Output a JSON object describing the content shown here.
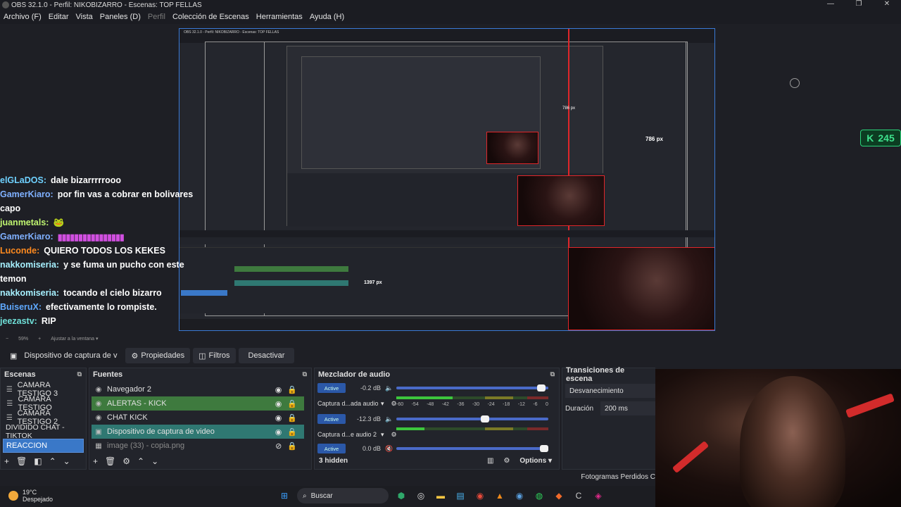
{
  "window": {
    "title": "OBS 32.1.0 - Perfil: NIKOBIZARRO - Escenas: TOP FELLAS",
    "controls": [
      "—",
      "❐",
      "✕"
    ]
  },
  "menu": {
    "items": [
      "Archivo (F)",
      "Editar",
      "Vista",
      "Paneles (D)",
      "Perfil",
      "Colección de Escenas",
      "Herramientas",
      "Ayuda (H)"
    ]
  },
  "preview": {
    "badge": "245",
    "nested_title": "OBS 32.1.0 - Perfil: NIKOBIZARRO - Escenas: TOP FELLAS",
    "nested_size_label": "786 px",
    "nested_size_label_2": "786 px",
    "nested_x_label": "1397 px"
  },
  "chat": {
    "lines": [
      {
        "user": "elGLaDOS:",
        "msg": "dale bizarrrrrooo",
        "color": "#6fd1ff"
      },
      {
        "user": "GamerKiaro:",
        "msg": "por fin vas a cobrar en bolivares",
        "color": "#7fb0ff"
      },
      {
        "user": "",
        "msg": "capo",
        "color": "#ffffff"
      },
      {
        "user": "juanmetals:",
        "msg": "🐸",
        "color": "#bff570"
      },
      {
        "user": "GamerKiaro:",
        "msg": "▮▮▮▮▮▮▮▮▮▮▮▮▮▮▮▮",
        "color": "#7fb0ff"
      },
      {
        "user": "Luconde:",
        "msg": "QUIERO TODOS LOS KEKES",
        "color": "#ff8a1f"
      },
      {
        "user": "nakkomiseria:",
        "msg": "y se fuma un pucho con este",
        "color": "#a6f0ff"
      },
      {
        "user": "",
        "msg": "temon",
        "color": "#ffffff"
      },
      {
        "user": "nakkomiseria:",
        "msg": "tocando el cielo bizarro",
        "color": "#a6f0ff"
      },
      {
        "user": "BuiseruX:",
        "msg": "efectivamente lo rompiste.",
        "color": "#5fa9ff"
      },
      {
        "user": "jeezastv:",
        "msg": "RIP",
        "color": "#6fe0d8"
      }
    ]
  },
  "zoom": {
    "minus": "−",
    "level": "59%",
    "plus": "+",
    "fit": "Ajustar a la ventana",
    "caret": "▾"
  },
  "source_toolbar": {
    "source": "Dispositivo de captura de v",
    "properties": "Propiedades",
    "filters": "Filtros",
    "deactivate": "Desactivar"
  },
  "scenes": {
    "title": "Escenas",
    "items": [
      "CAMARA TESTIGO 3",
      "CAMARA TESTIGO",
      "CAMARA TESTIGO 2",
      "DIVIDIDO CHAT - TIKTOK",
      "REACCION"
    ],
    "selected": 4
  },
  "sources": {
    "title": "Fuentes",
    "items": [
      "Navegador 2",
      "ALERTAS - KICK",
      "CHAT KICK",
      "Dispositivo de captura de video",
      "image (33) - copia.png"
    ]
  },
  "mixer": {
    "title": "Mezclador de audio",
    "channels": [
      {
        "label": "",
        "badge": "Active",
        "db": "-0.2 dB",
        "level": 0.97,
        "muted": false
      },
      {
        "label": "Captura d...ada audio",
        "badge": "",
        "db": "",
        "level": 0.4,
        "muted": false
      },
      {
        "label": "",
        "badge": "Active",
        "db": "-12.3 dB",
        "level": 0.6,
        "muted": false
      },
      {
        "label": "Captura d...e audio 2",
        "badge": "",
        "db": "",
        "level": 0.3,
        "muted": false
      },
      {
        "label": "",
        "badge": "Active",
        "db": "0.0 dB",
        "level": 1.0,
        "muted": true
      }
    ],
    "ticks": [
      "-60",
      "-54",
      "-48",
      "-42",
      "-36",
      "-30",
      "-24",
      "-18",
      "-12",
      "-6",
      "0"
    ],
    "hidden": "3 hidden",
    "options": "Options"
  },
  "transitions": {
    "title": "Transiciones de escena",
    "selected": "Desvanecimiento",
    "duration_label": "Duración",
    "duration_value": "200 ms"
  },
  "status": {
    "frames": "Fotogramas Perdidos C"
  },
  "taskbar": {
    "temp": "19°C",
    "weather": "Despejado",
    "search": "Buscar"
  }
}
